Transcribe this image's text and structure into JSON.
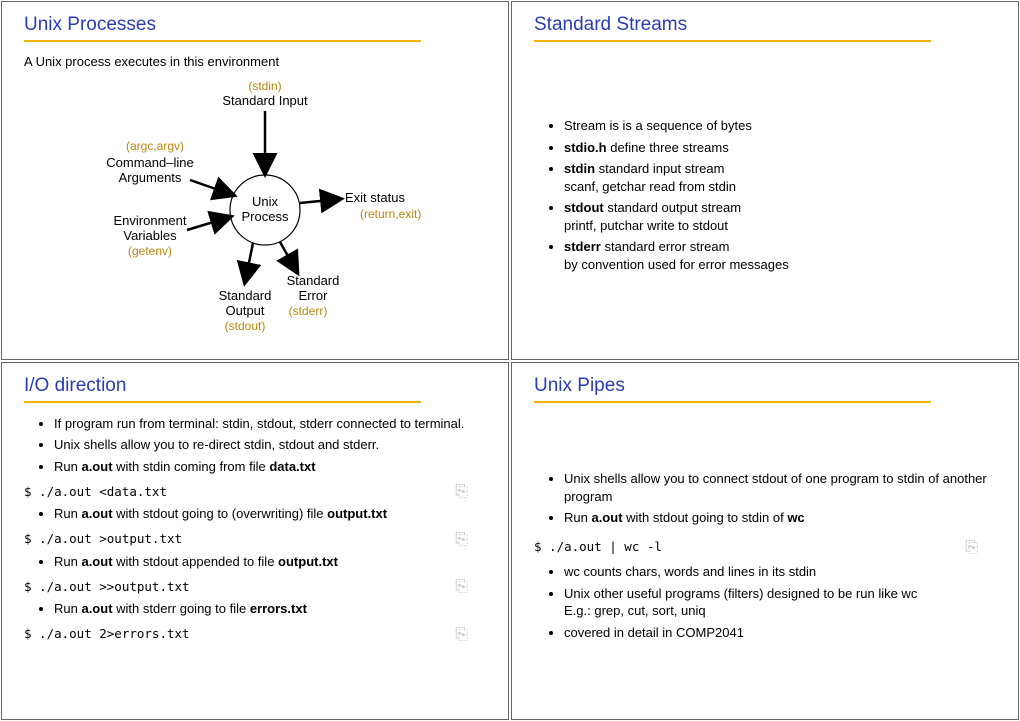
{
  "slides": {
    "s1": {
      "title": "Unix Processes",
      "intro": "A Unix process executes in this environment",
      "diagram": {
        "center1": "Unix",
        "center2": "Process",
        "stdin_mono": "(stdin)",
        "stdin_lbl": "Standard Input",
        "argv_mono": "(argc,argv)",
        "argv_lbl1": "Command–line",
        "argv_lbl2": "Arguments",
        "env_lbl1": "Environment",
        "env_lbl2": "Variables",
        "env_mono": "(getenv)",
        "exit_lbl": "Exit status",
        "exit_mono": "(return,exit)",
        "stdout_lbl1": "Standard",
        "stdout_lbl2": "Output",
        "stdout_mono": "(stdout)",
        "stderr_lbl1": "Standard",
        "stderr_lbl2": "Error",
        "stderr_mono": "(stderr)"
      }
    },
    "s2": {
      "title": "Standard Streams",
      "items": {
        "i0": "Stream is is a sequence of bytes",
        "i1_a": "stdio.h",
        "i1_b": " define three streams",
        "i2_a": "stdin",
        "i2_b": " standard input stream",
        "i2_sub": "scanf, getchar read from stdin",
        "i3_a": "stdout",
        "i3_b": " standard output stream",
        "i3_sub": "printf, putchar write to stdout",
        "i4_a": "stderr",
        "i4_b": " standard error stream",
        "i4_sub": "by convention used for error messages"
      }
    },
    "s3": {
      "title": "I/O direction",
      "items": {
        "i0": "If program run from terminal: stdin, stdout, stderr connected to terminal.",
        "i1": "Unix shells allow you to re-direct stdin, stdout and stderr.",
        "i2_a": "Run ",
        "i2_b": "a.out",
        "i2_c": " with stdin coming from file ",
        "i2_d": "data.txt",
        "c1": "$ ./a.out <data.txt",
        "i3_a": "Run ",
        "i3_b": "a.out",
        "i3_c": " with stdout going to (overwriting) file ",
        "i3_d": "output.txt",
        "c2": "$ ./a.out >output.txt",
        "i4_a": "Run ",
        "i4_b": "a.out",
        "i4_c": " with stdout appended to file ",
        "i4_d": "output.txt",
        "c3": "$ ./a.out >>output.txt",
        "i5_a": "Run ",
        "i5_b": "a.out",
        "i5_c": " with stderr going to file ",
        "i5_d": "errors.txt",
        "c4": "$ ./a.out 2>errors.txt"
      }
    },
    "s4": {
      "title": "Unix Pipes",
      "items": {
        "i0": "Unix shells allow you to connect stdout of one program to stdin of another program",
        "i1_a": "Run ",
        "i1_b": "a.out",
        "i1_c": " with stdout going to stdin of ",
        "i1_d": "wc",
        "c1": "$ ./a.out | wc -l",
        "i2": "wc counts chars, words and lines in its stdin",
        "i3_a": "Unix other useful programs (filters) designed to be run like wc",
        "i3_sub": "E.g.: grep, cut, sort, uniq",
        "i4": "covered in detail in COMP2041"
      }
    }
  }
}
